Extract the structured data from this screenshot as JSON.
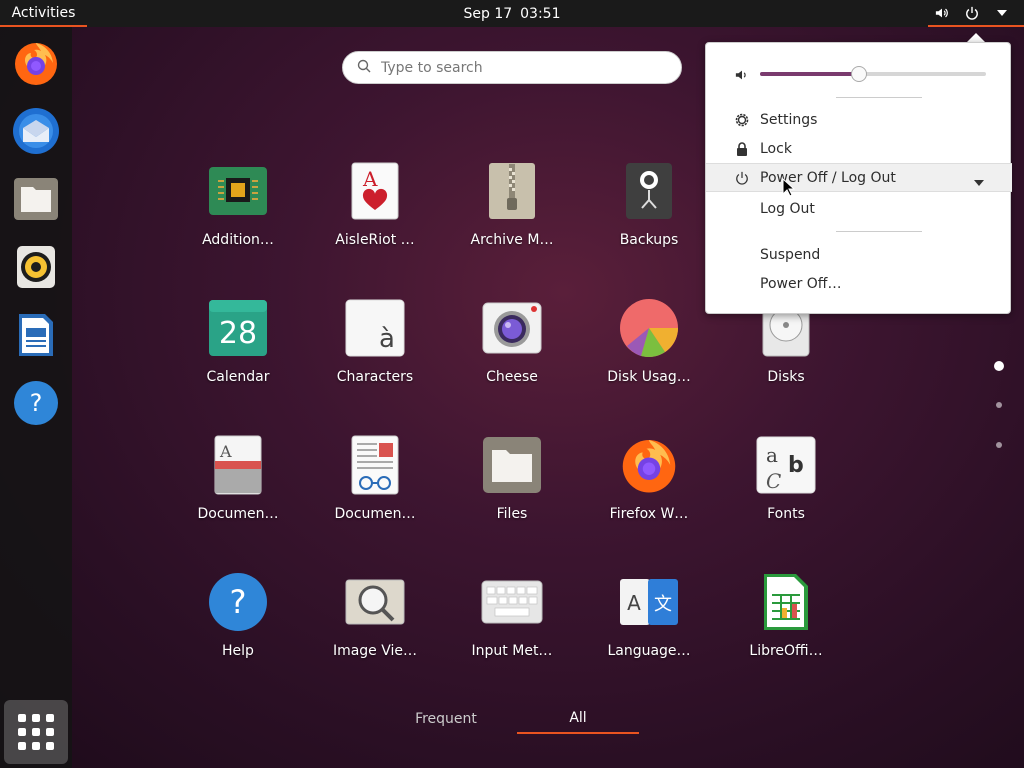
{
  "topbar": {
    "activities": "Activities",
    "date": "Sep 17",
    "time": "03:51",
    "accent_color": "#e95420"
  },
  "dock": {
    "items": [
      {
        "name": "firefox"
      },
      {
        "name": "thunderbird"
      },
      {
        "name": "files"
      },
      {
        "name": "rhythmbox"
      },
      {
        "name": "libreoffice-writer"
      },
      {
        "name": "help"
      }
    ],
    "show_apps": "show-apps-grid-icon"
  },
  "search": {
    "placeholder": "Type to search"
  },
  "apps": [
    {
      "label": "Addition…",
      "icon": "chip-icon"
    },
    {
      "label": "AisleRiot …",
      "icon": "playing-card-icon"
    },
    {
      "label": "Archive M…",
      "icon": "archive-zip-icon"
    },
    {
      "label": "Backups",
      "icon": "safe-icon"
    },
    {
      "label": "Calendar",
      "icon": "calendar-icon",
      "day": "28"
    },
    {
      "label": "Characters",
      "icon": "characters-icon",
      "glyph": "à"
    },
    {
      "label": "Cheese",
      "icon": "camera-icon"
    },
    {
      "label": "Disk Usag…",
      "icon": "pie-chart-icon"
    },
    {
      "label": "Disks",
      "icon": "disk-icon"
    },
    {
      "label": "Documen…",
      "icon": "document-viewer-icon"
    },
    {
      "label": "Documen…",
      "icon": "document-scanner-icon"
    },
    {
      "label": "Files",
      "icon": "folder-icon"
    },
    {
      "label": "Firefox W…",
      "icon": "firefox-icon"
    },
    {
      "label": "Fonts",
      "icon": "fonts-icon"
    },
    {
      "label": "Help",
      "icon": "help-icon"
    },
    {
      "label": "Image Vie…",
      "icon": "image-viewer-icon"
    },
    {
      "label": "Input Met…",
      "icon": "keyboard-icon"
    },
    {
      "label": "Language…",
      "icon": "language-icon"
    },
    {
      "label": "LibreOffi…",
      "icon": "spreadsheet-icon"
    }
  ],
  "pagination": {
    "pages": 3,
    "current": 1
  },
  "tabs": [
    {
      "label": "Frequent",
      "active": false
    },
    {
      "label": "All",
      "active": true
    }
  ],
  "system_menu": {
    "volume": 0.44,
    "settings": "Settings",
    "lock": "Lock",
    "power_off_logout": "Power Off / Log Out",
    "log_out": "Log Out",
    "suspend": "Suspend",
    "power_off": "Power Off…",
    "slider_color": "#7a3a6e"
  }
}
